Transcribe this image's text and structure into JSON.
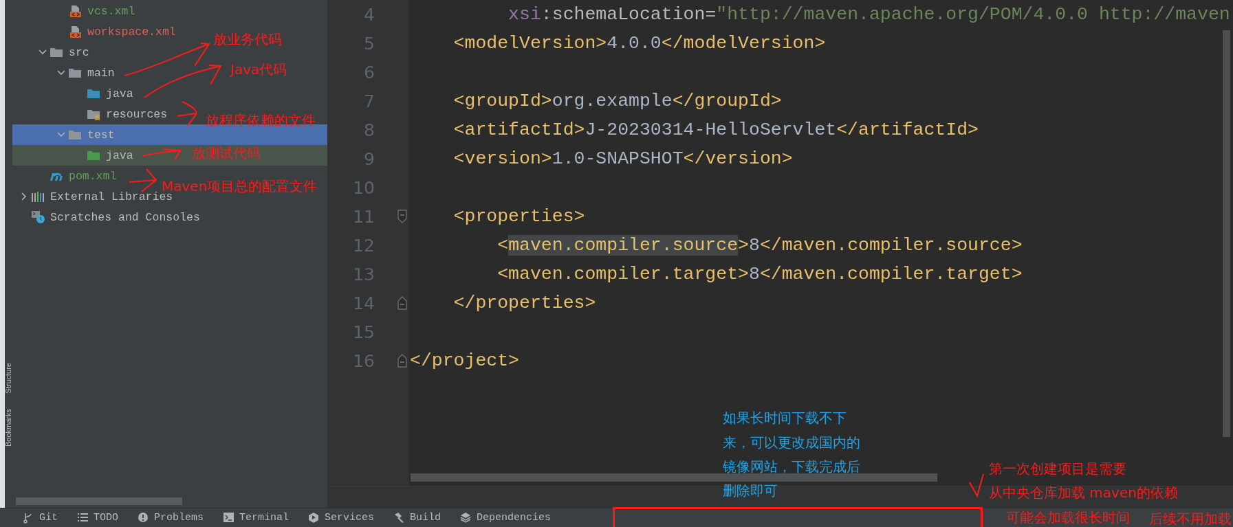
{
  "side_stripe": {
    "tabs": [
      {
        "label": "Structure"
      },
      {
        "label": "Bookmarks"
      }
    ]
  },
  "project_tree": {
    "scrolled_folder_items": [
      {
        "label": "vcs.xml",
        "kind": "xml-file",
        "color": "#62a05a",
        "selected": false,
        "highlighted": false
      },
      {
        "label": "workspace.xml",
        "kind": "xml-file",
        "color": "#d1675a",
        "selected": false,
        "highlighted": false
      }
    ],
    "project_items": [
      {
        "label": "src",
        "kind": "folder",
        "color": "#bbbbbb",
        "expanded": true,
        "selected": false,
        "highlighted": false,
        "children": [
          {
            "label": "main",
            "kind": "folder",
            "color": "#bbbbbb",
            "expanded": true,
            "selected": false,
            "highlighted": false,
            "children": [
              {
                "label": "java",
                "kind": "source-folder",
                "color": "#bbbbbb",
                "selected": false,
                "highlighted": false
              },
              {
                "label": "resources",
                "kind": "resources-folder",
                "color": "#bbbbbb",
                "selected": false,
                "highlighted": false
              }
            ]
          },
          {
            "label": "test",
            "kind": "folder",
            "color": "#bbbbbb",
            "expanded": true,
            "selected": true,
            "highlighted": false,
            "children": [
              {
                "label": "java",
                "kind": "test-folder",
                "color": "#bbbbbb",
                "selected": false,
                "highlighted": true
              }
            ]
          }
        ]
      },
      {
        "label": "pom.xml",
        "kind": "maven-file",
        "color": "#62a05a",
        "selected": false,
        "highlighted": false
      }
    ],
    "root_items": [
      {
        "label": "External Libraries",
        "kind": "libraries",
        "color": "#bbbbbb",
        "expanded": false,
        "selected": false,
        "highlighted": false
      },
      {
        "label": "Scratches and Consoles",
        "kind": "scratches",
        "color": "#bbbbbb",
        "selected": false,
        "highlighted": false
      }
    ]
  },
  "editor": {
    "lines": [
      {
        "number": "4",
        "kind": "plain",
        "tokens": [
          {
            "kind": "attr-ns",
            "text": "         xsi"
          },
          {
            "kind": "attr",
            "text": ":schemaLocation="
          },
          {
            "kind": "string",
            "text": "\"http://maven.apache.org/POM/4.0.0 http://maven"
          }
        ]
      },
      {
        "number": "5",
        "kind": "plain",
        "tokens": [
          {
            "kind": "tag",
            "text": "    <modelVersion>"
          },
          {
            "kind": "text",
            "text": "4.0.0"
          },
          {
            "kind": "tag",
            "text": "</modelVersion>"
          }
        ]
      },
      {
        "number": "6",
        "kind": "plain"
      },
      {
        "number": "7",
        "kind": "plain",
        "tokens": [
          {
            "kind": "tag",
            "text": "    <groupId>"
          },
          {
            "kind": "text",
            "text": "org.example"
          },
          {
            "kind": "tag",
            "text": "</groupId>"
          }
        ]
      },
      {
        "number": "8",
        "kind": "plain",
        "tokens": [
          {
            "kind": "tag",
            "text": "    <artifactId>"
          },
          {
            "kind": "text",
            "text": "J-20230314-HelloServlet"
          },
          {
            "kind": "tag",
            "text": "</artifactId>"
          }
        ]
      },
      {
        "number": "9",
        "kind": "plain",
        "tokens": [
          {
            "kind": "tag",
            "text": "    <version>"
          },
          {
            "kind": "text",
            "text": "1.0-SNAPSHOT"
          },
          {
            "kind": "tag",
            "text": "</version>"
          }
        ]
      },
      {
        "number": "10",
        "kind": "plain"
      },
      {
        "number": "11",
        "kind": "fold-start",
        "tokens": [
          {
            "kind": "tag",
            "text": "    <properties>"
          }
        ]
      },
      {
        "number": "12",
        "kind": "plain",
        "tokens": [
          {
            "kind": "tag",
            "text": "        <"
          },
          {
            "kind": "tag",
            "text": "maven.compiler.source",
            "highlighted": true
          },
          {
            "kind": "tag",
            "text": ">"
          },
          {
            "kind": "text",
            "text": "8"
          },
          {
            "kind": "tag",
            "text": "</maven.compiler.source>"
          }
        ]
      },
      {
        "number": "13",
        "kind": "plain",
        "tokens": [
          {
            "kind": "tag",
            "text": "        <maven.compiler.target>"
          },
          {
            "kind": "text",
            "text": "8"
          },
          {
            "kind": "tag",
            "text": "</maven.compiler.target>"
          }
        ]
      },
      {
        "number": "14",
        "kind": "fold-end",
        "tokens": [
          {
            "kind": "tag",
            "text": "    </properties>"
          }
        ]
      },
      {
        "number": "15",
        "kind": "plain"
      },
      {
        "number": "16",
        "kind": "fold-end",
        "tokens": [
          {
            "kind": "tag",
            "text": "</project>"
          }
        ]
      }
    ]
  },
  "tool_windows": [
    {
      "kind": "git",
      "label": "Git"
    },
    {
      "kind": "todo",
      "label": "TODO"
    },
    {
      "kind": "problems",
      "label": "Problems"
    },
    {
      "kind": "terminal",
      "label": "Terminal"
    },
    {
      "kind": "services",
      "label": "Services"
    },
    {
      "kind": "build",
      "label": "Build"
    },
    {
      "kind": "dependencies",
      "label": "Dependencies"
    }
  ],
  "annotations": [
    {
      "text": "放业务代码",
      "color": "#ff1a1a"
    },
    {
      "text": "Java代码",
      "color": "#ff1a1a"
    },
    {
      "text": "放程序依赖的文件",
      "color": "#ff1a1a"
    },
    {
      "text": "放测试代码",
      "color": "#ff1a1a"
    },
    {
      "text": "Maven项目总的配置文件",
      "color": "#ff1a1a"
    },
    {
      "text": "如果长时间下载不下",
      "color": "#1aa3e8"
    },
    {
      "text": "来，可以更改成国内的",
      "color": "#1aa3e8"
    },
    {
      "text": "镜像网站，下载完成后",
      "color": "#1aa3e8"
    },
    {
      "text": "删除即可",
      "color": "#1aa3e8"
    },
    {
      "text": "第一次创建项目是需要",
      "color": "#ff1a1a"
    },
    {
      "text": "从中央仓库加载 maven的依赖",
      "color": "#ff1a1a"
    },
    {
      "text": "可能会加载很长时间",
      "color": "#ff1a1a"
    },
    {
      "text": "后续不用加载",
      "color": "#ff1a1a"
    }
  ]
}
